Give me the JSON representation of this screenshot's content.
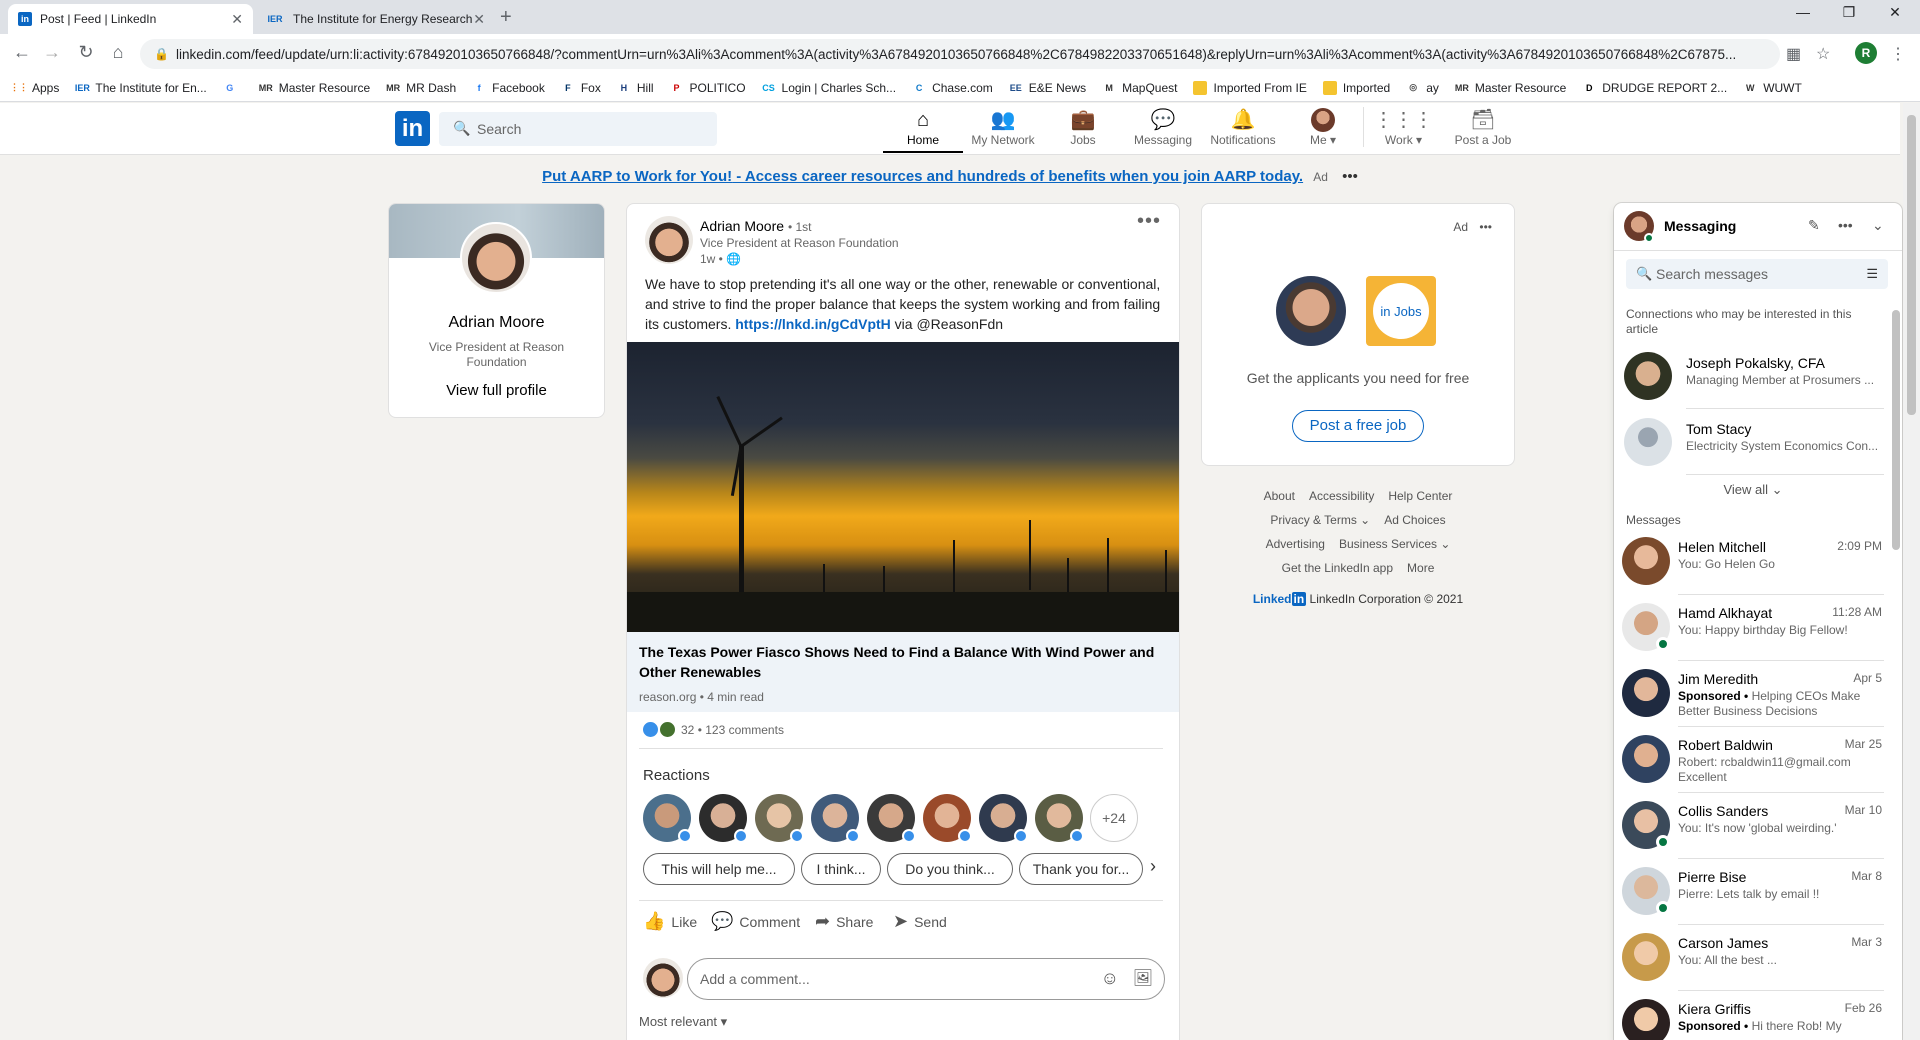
{
  "browser": {
    "tabs": [
      {
        "title": "Post | Feed | LinkedIn",
        "active": true,
        "favicon": "in"
      },
      {
        "title": "The Institute for Energy Research",
        "active": false,
        "favicon": "IER"
      }
    ],
    "url": "linkedin.com/feed/update/urn:li:activity:6784920103650766848/?commentUrn=urn%3Ali%3Acomment%3A(activity%3A6784920103650766848%2C6784982203370651648)&replyUrn=urn%3Ali%3Acomment%3A(activity%3A6784920103650766848%2C67875...",
    "profile_initial": "R",
    "bookmarks": [
      {
        "label": "Apps",
        "icon": "apps-grid-icon"
      },
      {
        "label": "The Institute for En...",
        "icon": "IER"
      },
      {
        "label": "",
        "icon": "G"
      },
      {
        "label": "Master Resource",
        "icon": "MR"
      },
      {
        "label": "MR Dash",
        "icon": "MR"
      },
      {
        "label": "Facebook",
        "icon": "f"
      },
      {
        "label": "Fox",
        "icon": "F"
      },
      {
        "label": "Hill",
        "icon": "H"
      },
      {
        "label": "POLITICO",
        "icon": "P"
      },
      {
        "label": "Login | Charles Sch...",
        "icon": "CS"
      },
      {
        "label": "Chase.com",
        "icon": "C"
      },
      {
        "label": "E&E News",
        "icon": "EE"
      },
      {
        "label": "MapQuest",
        "icon": "M"
      },
      {
        "label": "Imported From IE",
        "icon": "folder"
      },
      {
        "label": "Imported",
        "icon": "folder"
      },
      {
        "label": "ay",
        "icon": "globe"
      },
      {
        "label": "Master Resource",
        "icon": "MR"
      },
      {
        "label": "DRUDGE REPORT 2...",
        "icon": "D"
      },
      {
        "label": "WUWT",
        "icon": "W"
      }
    ]
  },
  "nav": {
    "logo": "in",
    "search_placeholder": "Search",
    "items": [
      {
        "label": "Home",
        "icon": "home-icon"
      },
      {
        "label": "My Network",
        "icon": "network-icon"
      },
      {
        "label": "Jobs",
        "icon": "jobs-icon"
      },
      {
        "label": "Messaging",
        "icon": "messaging-icon"
      },
      {
        "label": "Notifications",
        "icon": "bell-icon"
      },
      {
        "label": "Me ▾",
        "icon": "me-avatar"
      },
      {
        "label": "Work ▾",
        "icon": "grid-icon"
      },
      {
        "label": "Post a Job",
        "icon": "briefcase-icon"
      }
    ]
  },
  "ad_banner": {
    "link": "Put AARP to Work for You!",
    "text": " - Access career resources and hundreds of benefits when you join AARP today.",
    "tag": "Ad"
  },
  "profile": {
    "name": "Adrian Moore",
    "title": "Vice President at Reason Foundation",
    "view": "View full profile"
  },
  "post": {
    "author": "Adrian Moore",
    "degree": "• 1st",
    "headline": "Vice President at Reason Foundation",
    "time": "1w •",
    "text_before": "We have to stop pretending it's all one way or the other, renewable or conventional, and strive to find the proper balance that keeps the system working and from failing its customers. ",
    "link": "https://lnkd.in/gCdVptH",
    "text_after": " via @ReasonFdn",
    "article_title": "The Texas Power Fiasco Shows Need to Find a Balance With Wind Power and Other Renewables",
    "article_source": "reason.org • 4 min read",
    "reaction_count": "32",
    "comments_count": "• 123 comments",
    "reactions_label": "Reactions",
    "more_reactors": "+24",
    "chips": [
      "This will help me...",
      "I think...",
      "Do you think...",
      "Thank you for..."
    ],
    "actions": {
      "like": "Like",
      "comment": "Comment",
      "share": "Share",
      "send": "Send"
    },
    "comment_placeholder": "Add a comment...",
    "sort": "Most relevant ▾"
  },
  "ad_card": {
    "label": "Ad",
    "jobs_logo": "in Jobs",
    "text": "Get the applicants you need for free",
    "button": "Post a free job"
  },
  "footer": {
    "rows": [
      [
        "About",
        "Accessibility",
        "Help Center"
      ],
      [
        "Privacy & Terms ⌄",
        "Ad Choices"
      ],
      [
        "Advertising",
        "Business Services ⌄"
      ],
      [
        "Get the LinkedIn app",
        "More"
      ]
    ],
    "brand": "Linked",
    "brand_in": "in",
    "corp": "LinkedIn Corporation © 2021"
  },
  "messaging": {
    "title": "Messaging",
    "search_placeholder": "Search messages",
    "connections_label": "Connections who may be interested in this article",
    "connections": [
      {
        "name": "Joseph Pokalsky, CFA",
        "sub": "Managing Member at Prosumers ..."
      },
      {
        "name": "Tom Stacy",
        "sub": "Electricity System Economics Con..."
      }
    ],
    "view_all": "View all ⌄",
    "messages_label": "Messages",
    "messages": [
      {
        "name": "Helen Mitchell",
        "date": "2:09 PM",
        "preview": "You: Go Helen Go",
        "sponsored": "",
        "online": false
      },
      {
        "name": "Hamd Alkhayat",
        "date": "11:28 AM",
        "preview": "You: Happy birthday Big Fellow!",
        "sponsored": "",
        "online": true
      },
      {
        "name": "Jim Meredith",
        "date": "Apr 5",
        "preview": "Helping CEOs Make Better Business Decisions",
        "sponsored": "Sponsored •",
        "online": false
      },
      {
        "name": "Robert Baldwin",
        "date": "Mar 25",
        "preview": "Robert: rcbaldwin11@gmail.com Excellent",
        "sponsored": "",
        "online": false
      },
      {
        "name": "Collis Sanders",
        "date": "Mar 10",
        "preview": "You: It's now 'global weirding.'",
        "sponsored": "",
        "online": true
      },
      {
        "name": "Pierre Bise",
        "date": "Mar 8",
        "preview": "Pierre: Lets talk by email !!",
        "sponsored": "",
        "online": true
      },
      {
        "name": "Carson James",
        "date": "Mar 3",
        "preview": "You: All the best ...",
        "sponsored": "",
        "online": false
      },
      {
        "name": "Kiera Griffis",
        "date": "Feb 26",
        "preview": "Hi there Rob! My",
        "sponsored": "Sponsored •",
        "online": false
      }
    ]
  },
  "colors": {
    "linkedin_blue": "#0a66c2",
    "online_green": "#057642",
    "background": "#f3f2ef"
  }
}
